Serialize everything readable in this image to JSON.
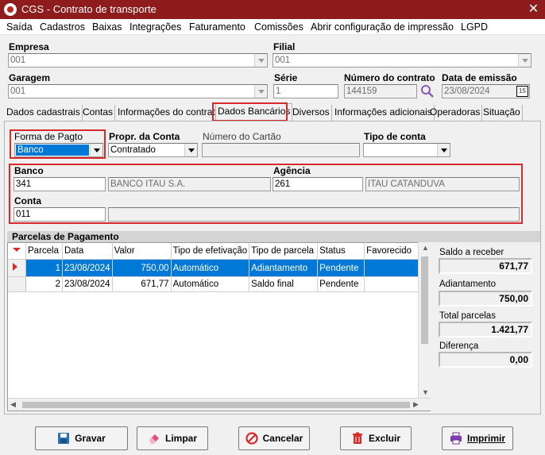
{
  "window": {
    "title": "CGS - Contrato de transporte",
    "close_glyph": "✕"
  },
  "menu": [
    "Saída",
    "Cadastros",
    "Baixas",
    "Integrações",
    "Faturamento",
    "Comissões",
    "Abrir configuração de impressão",
    "LGPD"
  ],
  "header": {
    "empresa": {
      "label": "Empresa",
      "value": "001"
    },
    "filial": {
      "label": "Filial",
      "value": "001"
    },
    "garagem": {
      "label": "Garagem",
      "value": "001"
    },
    "serie": {
      "label": "Série",
      "value": "1"
    },
    "numero": {
      "label": "Número do contrato",
      "value": "144159"
    },
    "data_emissao": {
      "label": "Data de emissão",
      "value": "23/08/2024",
      "calendar_glyph": "15"
    }
  },
  "tabs": [
    "Dados cadastrais",
    "Contas",
    "Informações do contrato",
    "Dados Bancários",
    "Diversos",
    "Informações adicionais",
    "Operadoras",
    "Situação"
  ],
  "active_tab": "Dados Bancários",
  "banking": {
    "forma_pagto": {
      "label": "Forma de Pagto",
      "value": "Banco"
    },
    "propr_conta": {
      "label": "Propr. da Conta",
      "value": "Contratado"
    },
    "numero_cartao": {
      "label": "Número do Cartão",
      "value": ""
    },
    "tipo_conta": {
      "label": "Tipo de conta",
      "value": ""
    },
    "banco": {
      "label": "Banco",
      "code": "341",
      "name": "BANCO ITAU S.A."
    },
    "agencia": {
      "label": "Agência",
      "code": "261",
      "name": "ITAU CATANDUVA"
    },
    "conta": {
      "label": "Conta",
      "value": "011",
      "extra": ""
    }
  },
  "parcelas": {
    "title": "Parcelas de Pagamento",
    "columns": [
      "Parcela",
      "Data",
      "Valor",
      "Tipo de efetivação",
      "Tipo de parcela",
      "Status",
      "Favorecido"
    ],
    "rows": [
      [
        "1",
        "23/08/2024",
        "750,00",
        "Automático",
        "Adiantamento",
        "Pendente",
        ""
      ],
      [
        "2",
        "23/08/2024",
        "671,77",
        "Automático",
        "Saldo final",
        "Pendente",
        ""
      ]
    ]
  },
  "summary": {
    "saldo": {
      "label": "Saldo a receber",
      "value": "671,77"
    },
    "adiantamento": {
      "label": "Adiantamento",
      "value": "750,00"
    },
    "total": {
      "label": "Total parcelas",
      "value": "1.421,77"
    },
    "diferenca": {
      "label": "Diferença",
      "value": "0,00"
    }
  },
  "buttons": {
    "gravar": "Gravar",
    "limpar": "Limpar",
    "cancelar": "Cancelar",
    "excluir": "Excluir",
    "imprimir": "Imprimir"
  },
  "colors": {
    "titlebar": "#8e1c1c",
    "highlight": "#d82a2a",
    "selection": "#0078d7"
  },
  "icons": [
    "app-logo-icon",
    "close-icon",
    "dropdown-arrow-icon",
    "search-icon",
    "calendar-icon",
    "row-indicator-icon",
    "save-icon",
    "eraser-icon",
    "cancel-icon",
    "trash-icon",
    "printer-icon"
  ]
}
